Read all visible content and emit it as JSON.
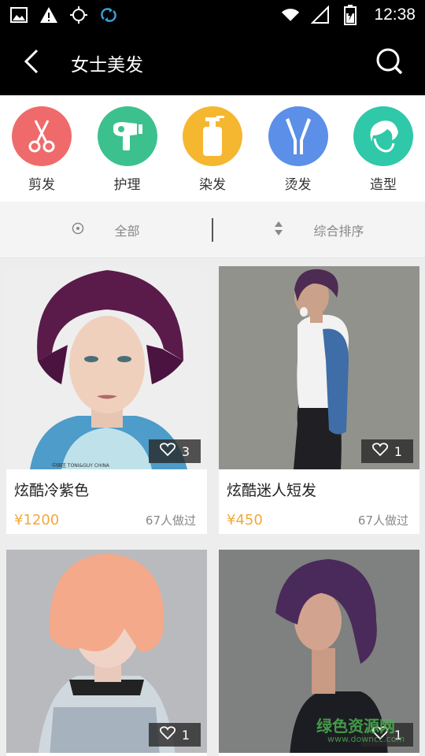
{
  "status_bar": {
    "time": "12:38",
    "icons": [
      "image-icon",
      "warning-icon",
      "gps-icon",
      "sync-icon",
      "wifi-icon",
      "signal-icon",
      "battery-icon"
    ]
  },
  "app_bar": {
    "title": "女士美发",
    "back_icon": "back-arrow-icon",
    "search_icon": "search-icon"
  },
  "categories": [
    {
      "label": "剪发",
      "icon": "scissors-icon",
      "color": "#ef6b6b"
    },
    {
      "label": "护理",
      "icon": "hair-dryer-icon",
      "color": "#3cc18e"
    },
    {
      "label": "染发",
      "icon": "spray-bottle-icon",
      "color": "#f5b730"
    },
    {
      "label": "烫发",
      "icon": "hair-iron-icon",
      "color": "#5b8fe8"
    },
    {
      "label": "造型",
      "icon": "hairstyle-icon",
      "color": "#2fc8a8"
    }
  ],
  "filters": {
    "area_label": "全部",
    "sort_label": "综合排序"
  },
  "items": [
    {
      "title": "炫酷冷紫色",
      "price": "¥1200",
      "done": "67人做过",
      "likes": "3",
      "photo_bg": "#e8e8e8",
      "photo_credit": "中国区 TONI&GUY CHINA"
    },
    {
      "title": "炫酷迷人短发",
      "price": "¥450",
      "done": "67人做过",
      "likes": "1",
      "photo_bg": "#8a8a86"
    },
    {
      "title": "",
      "price": "",
      "done": "",
      "likes": "1",
      "photo_bg": "#b9bbbd"
    },
    {
      "title": "",
      "price": "",
      "done": "",
      "likes": "1",
      "photo_bg": "#7d807e"
    }
  ],
  "watermark": {
    "text": "绿色资源网",
    "sub": "www.downcc.com"
  }
}
